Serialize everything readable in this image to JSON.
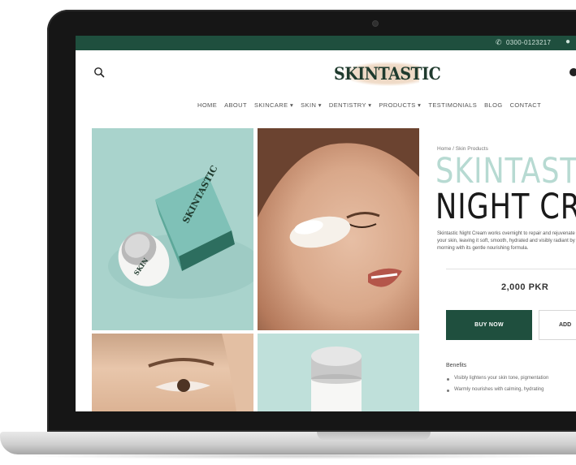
{
  "topbar": {
    "phone": "0300-0123217",
    "accent": "#1f4f3e"
  },
  "header": {
    "logo_text": "SKINTASTIC"
  },
  "nav": {
    "items": [
      "HOME",
      "ABOUT",
      "SKINCARE ▾",
      "SKIN ▾",
      "DENTISTRY ▾",
      "PRODUCTS ▾",
      "TESTIMONIALS",
      "BLOG",
      "CONTACT"
    ]
  },
  "product": {
    "breadcrumb": "Home / Skin Products",
    "title_line1": "SKINTAST",
    "title_line2": "NIGHT CRE",
    "description": "Skintastic Night Cream works overnight to repair and rejuvenate your skin, leaving it soft, smooth, hydrated and visibly radiant by morning with its gentle nourishing formula.",
    "price": "2,000 PKR",
    "buy_now_label": "BUY NOW",
    "add_label": "ADD",
    "benefits_label": "Benefits",
    "benefits": [
      "Visibly lightens your skin tone, pigmentation",
      "Warmly nourishes with calming, hydrating"
    ]
  },
  "colors": {
    "brand_green": "#1f4f3e",
    "mint": "#a9d3cc",
    "title_mint": "#b7dad2"
  },
  "icons": [
    "search-icon",
    "phone-icon",
    "user-icon",
    "cart-icon"
  ]
}
